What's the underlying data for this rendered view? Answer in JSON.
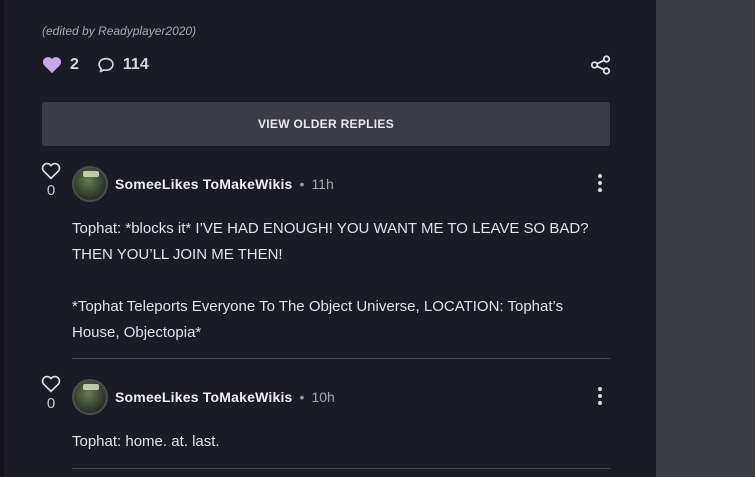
{
  "post": {
    "edited_note": "(edited by Readyplayer2020)",
    "likes": "2",
    "comments": "114"
  },
  "older_replies_label": "VIEW OLDER REPLIES",
  "replies": [
    {
      "likes": "0",
      "author": "SomeeLikes ToMakeWikis",
      "separator": "•",
      "time": "11h",
      "lines": [
        "Tophat: *blocks it* I’VE HAD ENOUGH! YOU WANT ME TO LEAVE SO BAD?",
        "THEN YOU’LL JOIN ME THEN!",
        "*Tophat Teleports Everyone To The Object Universe, LOCATION: Tophat’s",
        "House, Objectopia*"
      ]
    },
    {
      "likes": "0",
      "author": "SomeeLikes ToMakeWikis",
      "separator": "•",
      "time": "10h",
      "lines": [
        "Tophat: home. at. last."
      ]
    }
  ],
  "colors": {
    "accent_heart": "#c9a6ec",
    "background": "#1b1b25",
    "button": "#3b3c46",
    "side_panel": "#3a3b40"
  },
  "icons": {
    "like": "heart-icon",
    "comment": "comment-icon",
    "share": "share-icon",
    "more": "more-options-icon"
  }
}
